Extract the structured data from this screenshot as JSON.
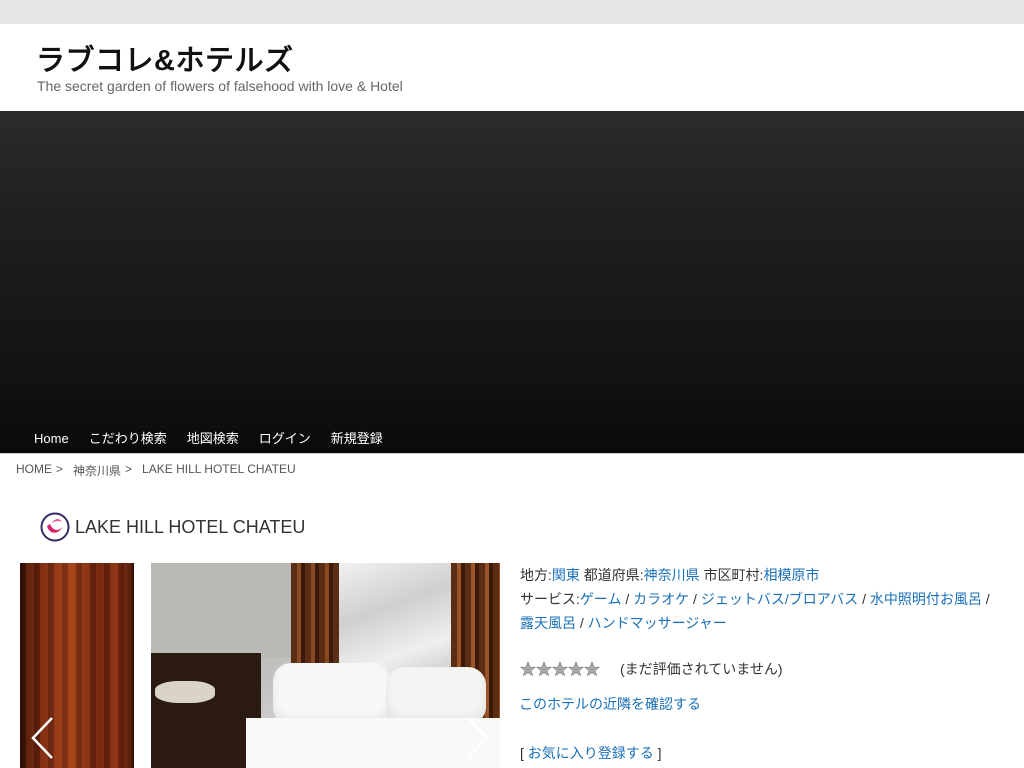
{
  "site": {
    "title": "ラブコレ&ホテルズ",
    "tagline": "The secret garden of flowers of falsehood with love & Hotel"
  },
  "nav": {
    "items": [
      "Home",
      "こだわり検索",
      "地図検索",
      "ログイン",
      "新規登録"
    ]
  },
  "breadcrumb": {
    "home": "HOME",
    "prefecture": "神奈川県",
    "current": "LAKE HILL HOTEL CHATEU",
    "separator": ">"
  },
  "hotel": {
    "name": "LAKE HILL HOTEL CHATEU",
    "region_label": "地方:",
    "region": "関東",
    "prefecture_label": "都道府県:",
    "prefecture": "神奈川県",
    "city_label": "市区町村:",
    "city": "相模原市",
    "services_label": "サービス:",
    "services": [
      "ゲーム",
      "カラオケ",
      "ジェットバス/ブロアバス",
      "水中照明付お風呂",
      "露天風呂",
      "ハンドマッサージャー"
    ],
    "service_separator": "/",
    "rating": {
      "stars_filled": 0,
      "stars_total": 5,
      "text": "(まだ評価されていません)"
    },
    "nearby_link": "このホテルの近隣を確認する",
    "favorite": {
      "open": "[",
      "label": "お気に入り登録する",
      "close": "]"
    }
  },
  "colors": {
    "link": "#1a70b8",
    "hero": "#1a1a1a",
    "topbar": "#e5e5e5"
  },
  "icons": {
    "prev": "chevron-left-icon",
    "next": "chevron-right-icon",
    "star": "star-icon",
    "logo": "hotel-logo-icon"
  }
}
